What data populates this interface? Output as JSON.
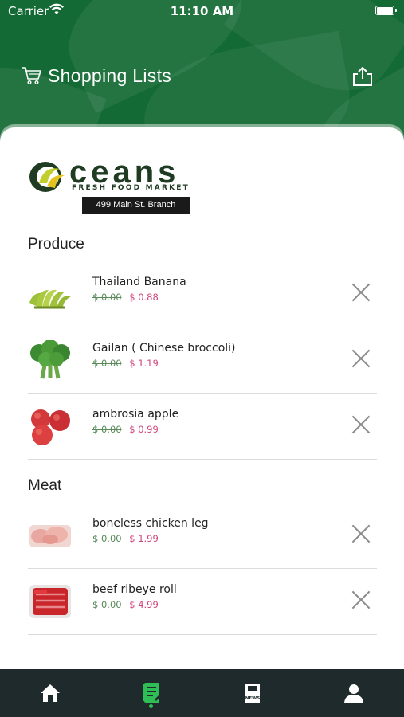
{
  "status_bar": {
    "carrier": "Carrier",
    "time": "11:10 AM"
  },
  "header": {
    "title": "Shopping Lists"
  },
  "store": {
    "logo_wordmark": "ceans",
    "logo_tagline": "FRESH FOOD MARKET",
    "branch": "499 Main St. Branch"
  },
  "sections": [
    {
      "title": "Produce",
      "items": [
        {
          "name": "Thailand Banana",
          "old_price": "$ 0.00",
          "new_price": "$ 0.88",
          "image": "banana"
        },
        {
          "name": "Gailan ( Chinese broccoli)",
          "old_price": "$ 0.00",
          "new_price": "$ 1.19",
          "image": "broccoli"
        },
        {
          "name": "ambrosia apple",
          "old_price": "$ 0.00",
          "new_price": "$ 0.99",
          "image": "apple"
        }
      ]
    },
    {
      "title": "Meat",
      "items": [
        {
          "name": "boneless chicken leg",
          "old_price": "$ 0.00",
          "new_price": "$ 1.99",
          "image": "chicken"
        },
        {
          "name": "beef ribeye roll",
          "old_price": "$ 0.00",
          "new_price": "$ 4.99",
          "image": "beef"
        }
      ]
    }
  ],
  "tabbar": {
    "tabs": [
      {
        "name": "home",
        "icon": "home-icon"
      },
      {
        "name": "shopping-list",
        "icon": "list-icon",
        "active": true
      },
      {
        "name": "news",
        "icon": "news-icon"
      },
      {
        "name": "profile",
        "icon": "user-icon"
      }
    ],
    "news_icon_text": "NEWS"
  },
  "colors": {
    "header_green": "#146a34",
    "accent_green": "#2fbd55",
    "price_pink": "#d0447a",
    "old_price_green": "#5a8a5a",
    "tabbar_bg": "#1e2a2c"
  }
}
